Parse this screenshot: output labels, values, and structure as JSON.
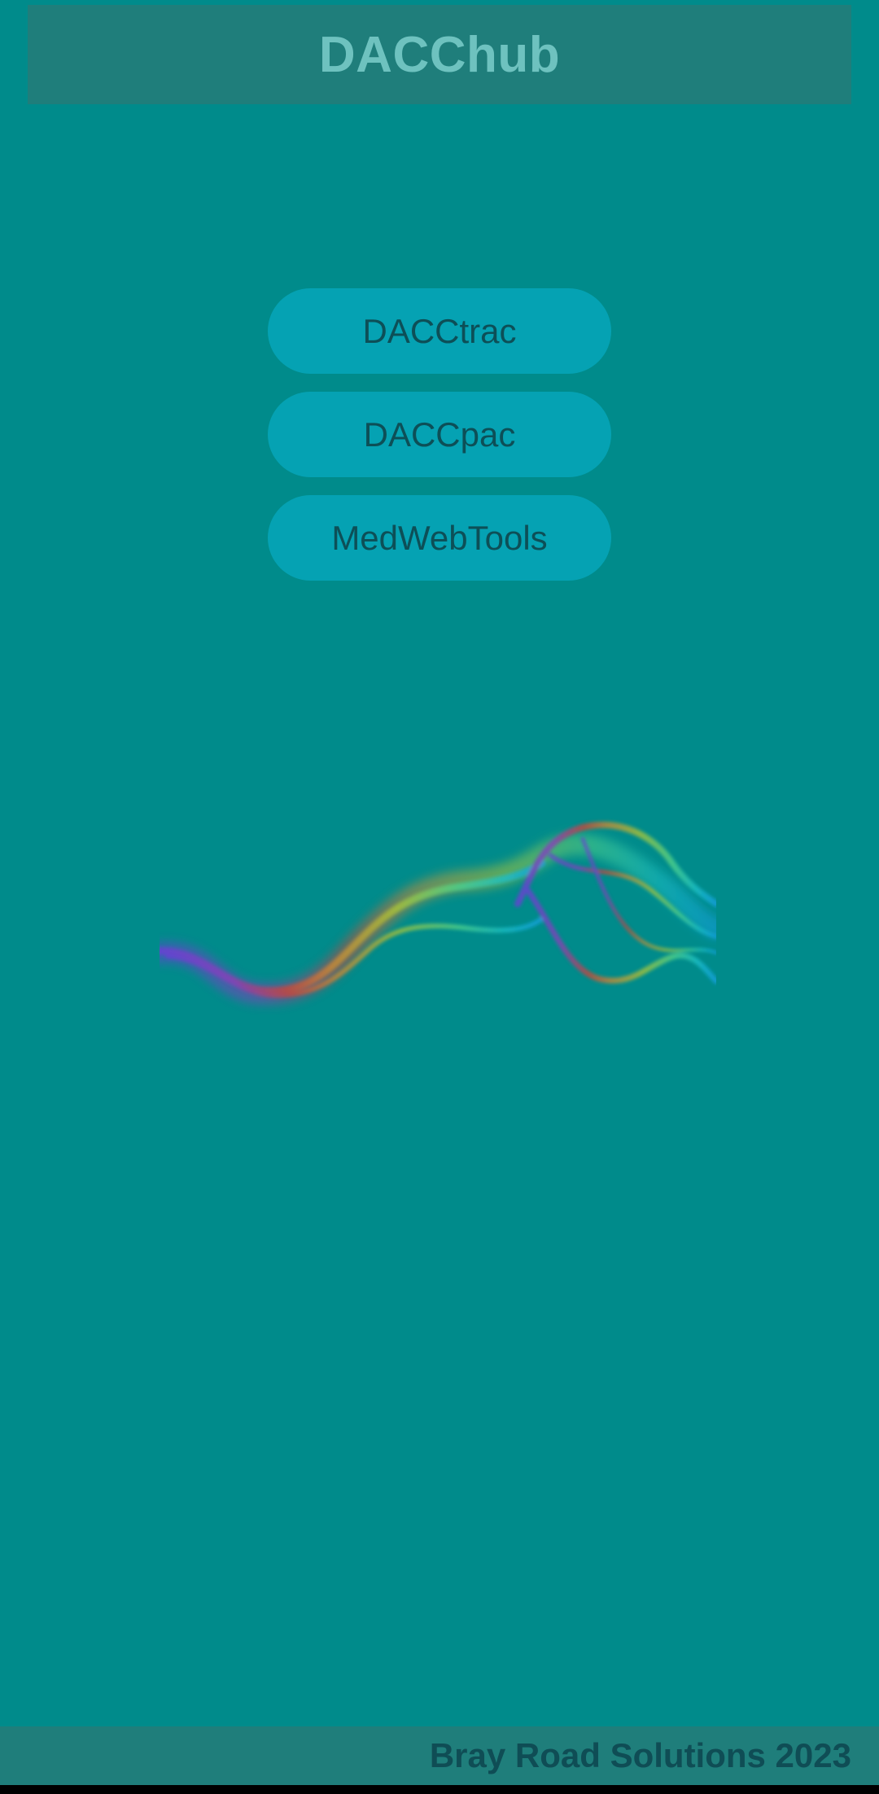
{
  "app": {
    "title": "DACChub"
  },
  "nav": {
    "buttons": [
      {
        "label": "DACCtrac"
      },
      {
        "label": "DACCpac"
      },
      {
        "label": "MedWebTools"
      }
    ]
  },
  "footer": {
    "text": "Bray Road Solutions 2023"
  },
  "colors": {
    "background": "#008b8b",
    "header_bg": "#1f7e7b",
    "button_bg": "#05a2b3",
    "button_text": "#0d4f57"
  }
}
